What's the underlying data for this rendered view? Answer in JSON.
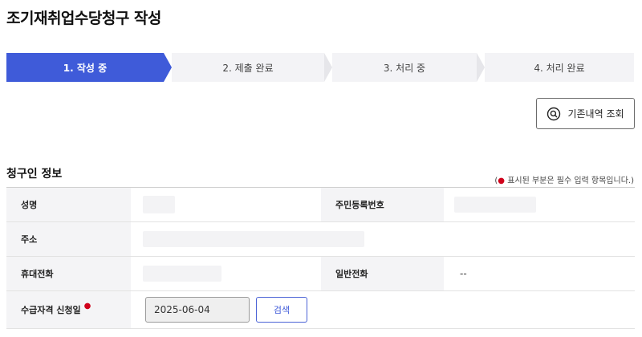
{
  "page": {
    "title": "조기재취업수당청구 작성"
  },
  "stepper": {
    "steps": [
      {
        "label": "1. 작성 중",
        "active": true
      },
      {
        "label": "2. 제출 완료",
        "active": false
      },
      {
        "label": "3. 처리 중",
        "active": false
      },
      {
        "label": "4. 처리 완료",
        "active": false
      }
    ],
    "colors": {
      "active": "#3f5bd9",
      "inactive": "#f3f3f6"
    }
  },
  "lookup": {
    "label": "기존내역 조회",
    "icon": "search-icon"
  },
  "section": {
    "title": "청구인 정보",
    "required_note_open": "(",
    "required_note_dot": "●",
    "required_note_text": " 표시된 부분은 필수 입력 항목입니다.)"
  },
  "fields": {
    "name_label": "성명",
    "rrn_label": "주민등록번호",
    "address_label": "주소",
    "mobile_label": "휴대전화",
    "phone_label": "일반전화",
    "phone_value": "--",
    "apply_date_label": "수급자격 신청일",
    "apply_date_required": "●",
    "apply_date_value": "2025-06-04",
    "search_label": "검색"
  }
}
